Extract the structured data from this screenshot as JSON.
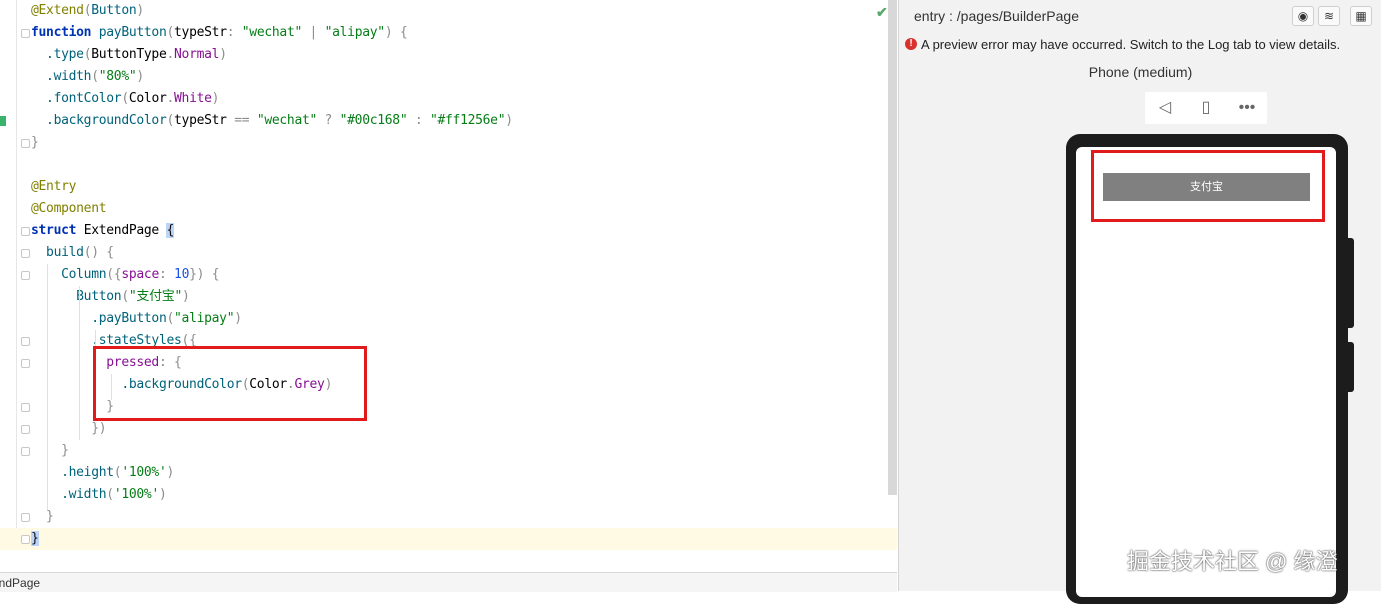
{
  "editor": {
    "lines": [
      [
        [
          "@Extend",
          "t-ann"
        ],
        [
          "(",
          "t-pun"
        ],
        [
          "Button",
          "t-fn"
        ],
        [
          ")",
          "t-pun"
        ]
      ],
      [
        [
          "function ",
          "t-kw"
        ],
        [
          "payButton",
          "t-fn"
        ],
        [
          "(",
          "t-pun"
        ],
        [
          "typeStr",
          "t-cls"
        ],
        [
          ": ",
          "t-pun"
        ],
        [
          "\"wechat\"",
          "t-str"
        ],
        [
          " | ",
          "t-pun"
        ],
        [
          "\"alipay\"",
          "t-str"
        ],
        [
          ") {",
          "t-pun"
        ]
      ],
      [
        [
          "  .type",
          "t-fn"
        ],
        [
          "(",
          "t-pun"
        ],
        [
          "ButtonType",
          "t-cls"
        ],
        [
          ".",
          "t-pun"
        ],
        [
          "Normal",
          "t-prop"
        ],
        [
          ")",
          "t-pun"
        ]
      ],
      [
        [
          "  .width",
          "t-fn"
        ],
        [
          "(",
          "t-pun"
        ],
        [
          "\"80%\"",
          "t-str"
        ],
        [
          ")",
          "t-pun"
        ]
      ],
      [
        [
          "  .fontColor",
          "t-fn"
        ],
        [
          "(",
          "t-pun"
        ],
        [
          "Color",
          "t-cls"
        ],
        [
          ".",
          "t-pun"
        ],
        [
          "White",
          "t-prop"
        ],
        [
          ")",
          "t-pun"
        ]
      ],
      [
        [
          "  .backgroundColor",
          "t-fn"
        ],
        [
          "(",
          "t-pun"
        ],
        [
          "typeStr",
          "t-cls"
        ],
        [
          " == ",
          "t-pun"
        ],
        [
          "\"wechat\"",
          "t-str"
        ],
        [
          " ? ",
          "t-pun"
        ],
        [
          "\"#00c168\"",
          "t-str"
        ],
        [
          " : ",
          "t-pun"
        ],
        [
          "\"#ff1256e\"",
          "t-str"
        ],
        [
          ")",
          "t-pun"
        ]
      ],
      [
        [
          "}",
          "t-pun"
        ]
      ],
      [],
      [
        [
          "@Entry",
          "t-ann"
        ]
      ],
      [
        [
          "@Component",
          "t-ann"
        ]
      ],
      [
        [
          "struct ",
          "t-kw"
        ],
        [
          "ExtendPage ",
          "t-cls"
        ],
        [
          "{",
          "brace-hl"
        ]
      ],
      [
        [
          "  build",
          "t-fn"
        ],
        [
          "() {",
          "t-pun"
        ]
      ],
      [
        [
          "    Column",
          "t-fn"
        ],
        [
          "({",
          "t-pun"
        ],
        [
          "space",
          "t-prop"
        ],
        [
          ": ",
          "t-pun"
        ],
        [
          "10",
          "t-num"
        ],
        [
          "}) {",
          "t-pun"
        ]
      ],
      [
        [
          "      Button",
          "t-fn"
        ],
        [
          "(",
          "t-pun"
        ],
        [
          "\"支付宝\"",
          "t-str"
        ],
        [
          ")",
          "t-pun"
        ]
      ],
      [
        [
          "        .payButton",
          "t-fn"
        ],
        [
          "(",
          "t-pun"
        ],
        [
          "\"alipay\"",
          "t-str"
        ],
        [
          ")",
          "t-pun"
        ]
      ],
      [
        [
          "        .stateStyles",
          "t-fn"
        ],
        [
          "({",
          "t-pun"
        ]
      ],
      [
        [
          "          pressed",
          "t-prop"
        ],
        [
          ": {",
          "t-pun"
        ]
      ],
      [
        [
          "            .backgroundColor",
          "t-fn"
        ],
        [
          "(",
          "t-pun"
        ],
        [
          "Color",
          "t-cls"
        ],
        [
          ".",
          "t-pun"
        ],
        [
          "Grey",
          "t-prop"
        ],
        [
          ")",
          "t-pun"
        ]
      ],
      [
        [
          "          }",
          "t-pun"
        ]
      ],
      [
        [
          "        })",
          "t-pun"
        ]
      ],
      [
        [
          "    }",
          "t-pun"
        ]
      ],
      [
        [
          "    .height",
          "t-fn"
        ],
        [
          "(",
          "t-pun"
        ],
        [
          "'100%'",
          "t-str"
        ],
        [
          ")",
          "t-pun"
        ]
      ],
      [
        [
          "    .width",
          "t-fn"
        ],
        [
          "(",
          "t-pun"
        ],
        [
          "'100%'",
          "t-str"
        ],
        [
          ")",
          "t-pun"
        ]
      ],
      [
        [
          "  }",
          "t-pun"
        ]
      ],
      [
        [
          "}",
          "brace-hl"
        ]
      ]
    ],
    "status_file": "endPage"
  },
  "preview": {
    "path": "entry : /pages/BuilderPage",
    "error": "A preview error may have occurred. Switch to the Log tab to view details.",
    "device": "Phone (medium)",
    "button_label": "支付宝",
    "watermark": "掘金技术社区 @ 缘澄"
  },
  "colors": {
    "highlight_box": "#e11b1b",
    "button_bg": "#808080",
    "error": "#d9302c"
  }
}
